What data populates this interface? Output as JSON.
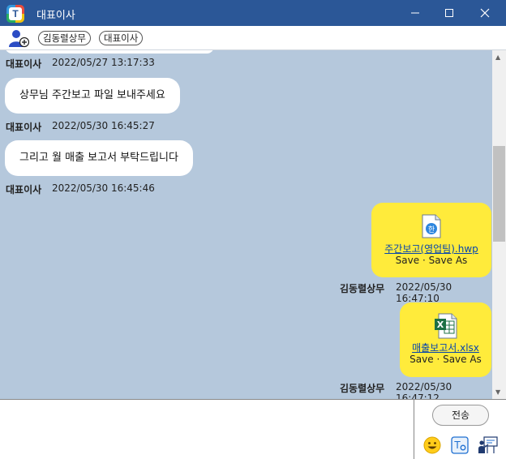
{
  "window": {
    "title": "대표이사"
  },
  "participants": [
    "김동렬상무",
    "대표이사"
  ],
  "messages": [
    {
      "sender": "대표이사",
      "time": "2022/05/27 13:17:33"
    },
    {
      "text": "상무님 주간보고 파일 보내주세요",
      "sender": "대표이사",
      "time": "2022/05/30 16:45:27"
    },
    {
      "text": "그리고 월 매출 보고서 부탁드립니다",
      "sender": "대표이사",
      "time": "2022/05/30 16:45:46"
    }
  ],
  "files": [
    {
      "filename": "주간보고(영업팀).hwp",
      "actions": "Save · Save As",
      "sender": "김동렬상무",
      "time": "2022/05/30 16:47:10",
      "icon": "hwp-file-icon"
    },
    {
      "filename": "매출보고서.xlsx",
      "actions": "Save · Save As",
      "sender": "김동렬상무",
      "time": "2022/05/30 16:47:12",
      "icon": "excel-file-icon"
    }
  ],
  "composer": {
    "send_label": "전송",
    "input_value": ""
  },
  "colors": {
    "titlebar": "#2b5797",
    "chat_bg": "#b5c8dc",
    "my_bubble": "#ffeb3b",
    "their_bubble": "#ffffff"
  }
}
